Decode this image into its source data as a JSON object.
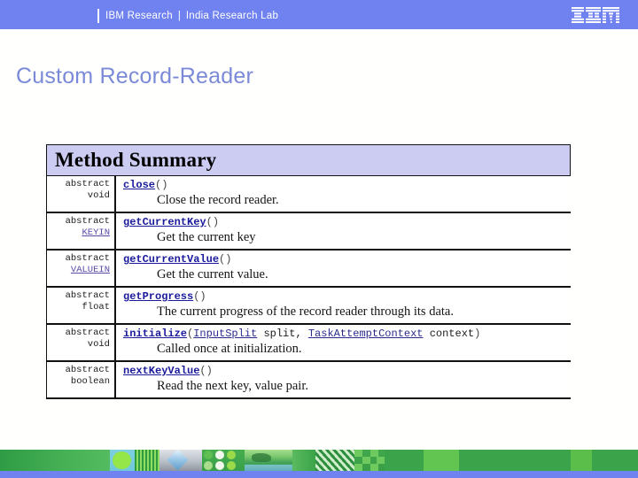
{
  "header": {
    "brand": "IBM Research",
    "separator": "|",
    "unit": "India Research Lab",
    "logo_icon": "ibm-logo-icon",
    "background_color": "#7082ef",
    "text_color": "#ffffff"
  },
  "slide": {
    "title": "Custom Record-Reader",
    "title_color": "#7a8ad8",
    "background_color": "#fffffd"
  },
  "method_summary": {
    "heading": "Method Summary",
    "heading_background": "#ccccf2",
    "link_color": "#1a1a9c",
    "type_link_color": "#5b4ba8",
    "rows": [
      {
        "modifier": "abstract",
        "return_type": "void",
        "return_type_is_link": false,
        "method": "close",
        "params_open": "(",
        "params": "",
        "params_close": ")",
        "description": "Close the record reader."
      },
      {
        "modifier": "abstract",
        "return_type": "KEYIN",
        "return_type_is_link": true,
        "method": "getCurrentKey",
        "params_open": "(",
        "params": "",
        "params_close": ")",
        "description": "Get the current key"
      },
      {
        "modifier": "abstract",
        "return_type": "VALUEIN",
        "return_type_is_link": true,
        "method": "getCurrentValue",
        "params_open": "(",
        "params": "",
        "params_close": ")",
        "description": "Get the current value."
      },
      {
        "modifier": "abstract",
        "return_type": "float",
        "return_type_is_link": false,
        "method": "getProgress",
        "params_open": "(",
        "params": "",
        "params_close": ")",
        "description": "The current progress of the record reader through its data."
      },
      {
        "modifier": "abstract",
        "return_type": "void",
        "return_type_is_link": false,
        "method": "initialize",
        "params_open": "(",
        "param_type_1": "InputSplit",
        "param_name_1": "split",
        "param_comma": ",",
        "param_type_2": "TaskAttemptContext",
        "param_name_2": "context",
        "params_close": ")",
        "description": "Called once at initialization."
      },
      {
        "modifier": "abstract",
        "return_type": "boolean",
        "return_type_is_link": false,
        "method": "nextKeyValue",
        "params_open": "(",
        "params": "",
        "params_close": ")",
        "description": "Read the next key, value pair."
      }
    ]
  },
  "footer": {
    "band_color": "#3ba349",
    "bottom_strip_color": "#7082ef",
    "decoration": "ibm-footer-graphic-band"
  }
}
